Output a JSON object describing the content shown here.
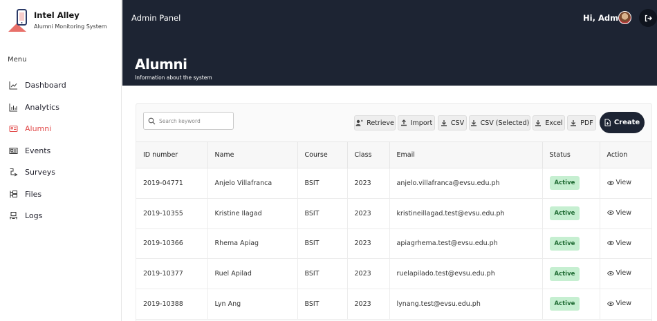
{
  "brand": {
    "name": "Intel Alley",
    "subtitle": "Alumni Monitoring System"
  },
  "sidebar": {
    "menu_label": "Menu",
    "items": [
      {
        "label": "Dashboard",
        "icon": "line-chart-icon"
      },
      {
        "label": "Analytics",
        "icon": "bar-chart-icon"
      },
      {
        "label": "Alumni",
        "icon": "id-card-icon",
        "active": true
      },
      {
        "label": "Events",
        "icon": "newspaper-icon"
      },
      {
        "label": "Surveys",
        "icon": "survey-icon"
      },
      {
        "label": "Files",
        "icon": "files-icon"
      },
      {
        "label": "Logs",
        "icon": "logs-icon"
      }
    ]
  },
  "header": {
    "panel_title": "Admin Panel",
    "greeting": "Hi, Admin",
    "page_title": "Alumni",
    "page_subtitle": "Information about the system"
  },
  "toolbar": {
    "search_placeholder": "Search keyword",
    "buttons": [
      "Retrieve",
      "Import",
      "CSV",
      "CSV (Selected)",
      "Excel",
      "PDF"
    ],
    "create_label": "Create"
  },
  "table": {
    "columns": [
      "ID number",
      "Name",
      "Course",
      "Class",
      "Email",
      "Status",
      "Action"
    ],
    "rows": [
      {
        "id": "2019-04771",
        "name": "Anjelo Villafranca",
        "course": "BSIT",
        "class": "2023",
        "email": "anjelo.villafranca@evsu.edu.ph",
        "status": "Active",
        "action": "View"
      },
      {
        "id": "2019-10355",
        "name": "Kristine Ilagad",
        "course": "BSIT",
        "class": "2023",
        "email": "kristineillagad.test@evsu.edu.ph",
        "status": "Active",
        "action": "View"
      },
      {
        "id": "2019-10366",
        "name": "Rhema Apiag",
        "course": "BSIT",
        "class": "2023",
        "email": "apiagrhema.test@evsu.edu.ph",
        "status": "Active",
        "action": "View"
      },
      {
        "id": "2019-10377",
        "name": "Ruel Apilad",
        "course": "BSIT",
        "class": "2023",
        "email": "ruelapilado.test@evsu.edu.ph",
        "status": "Active",
        "action": "View"
      },
      {
        "id": "2019-10388",
        "name": "Lyn Ang",
        "course": "BSIT",
        "class": "2023",
        "email": "lynang.test@evsu.edu.ph",
        "status": "Active",
        "action": "View"
      }
    ]
  },
  "colors": {
    "header_bg": "#1d2433",
    "active_nav": "#e24b4b",
    "status_bg": "#c6efd1",
    "status_text": "#1f6b33"
  }
}
